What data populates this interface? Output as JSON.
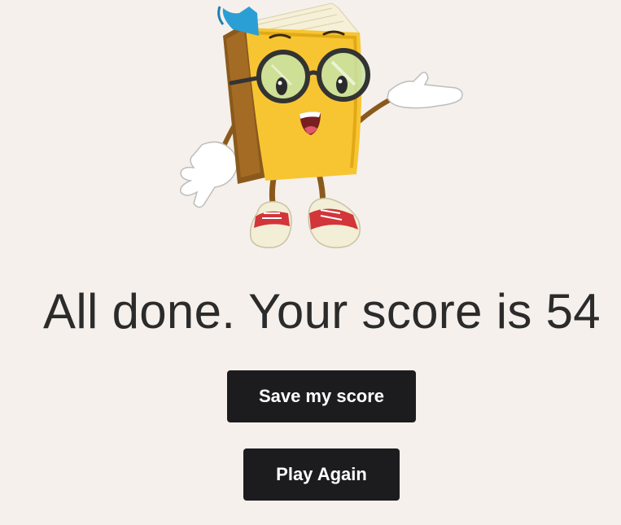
{
  "result": {
    "heading": "All done. Your score is 54"
  },
  "actions": {
    "save_label": "Save my score",
    "play_again_label": "Play Again"
  },
  "mascot": {
    "icon": "book-mascot-icon"
  },
  "colors": {
    "background": "#f5f0eb",
    "button": "#1c1c1e",
    "button_text": "#ffffff",
    "heading_text": "#2b2b2b"
  }
}
